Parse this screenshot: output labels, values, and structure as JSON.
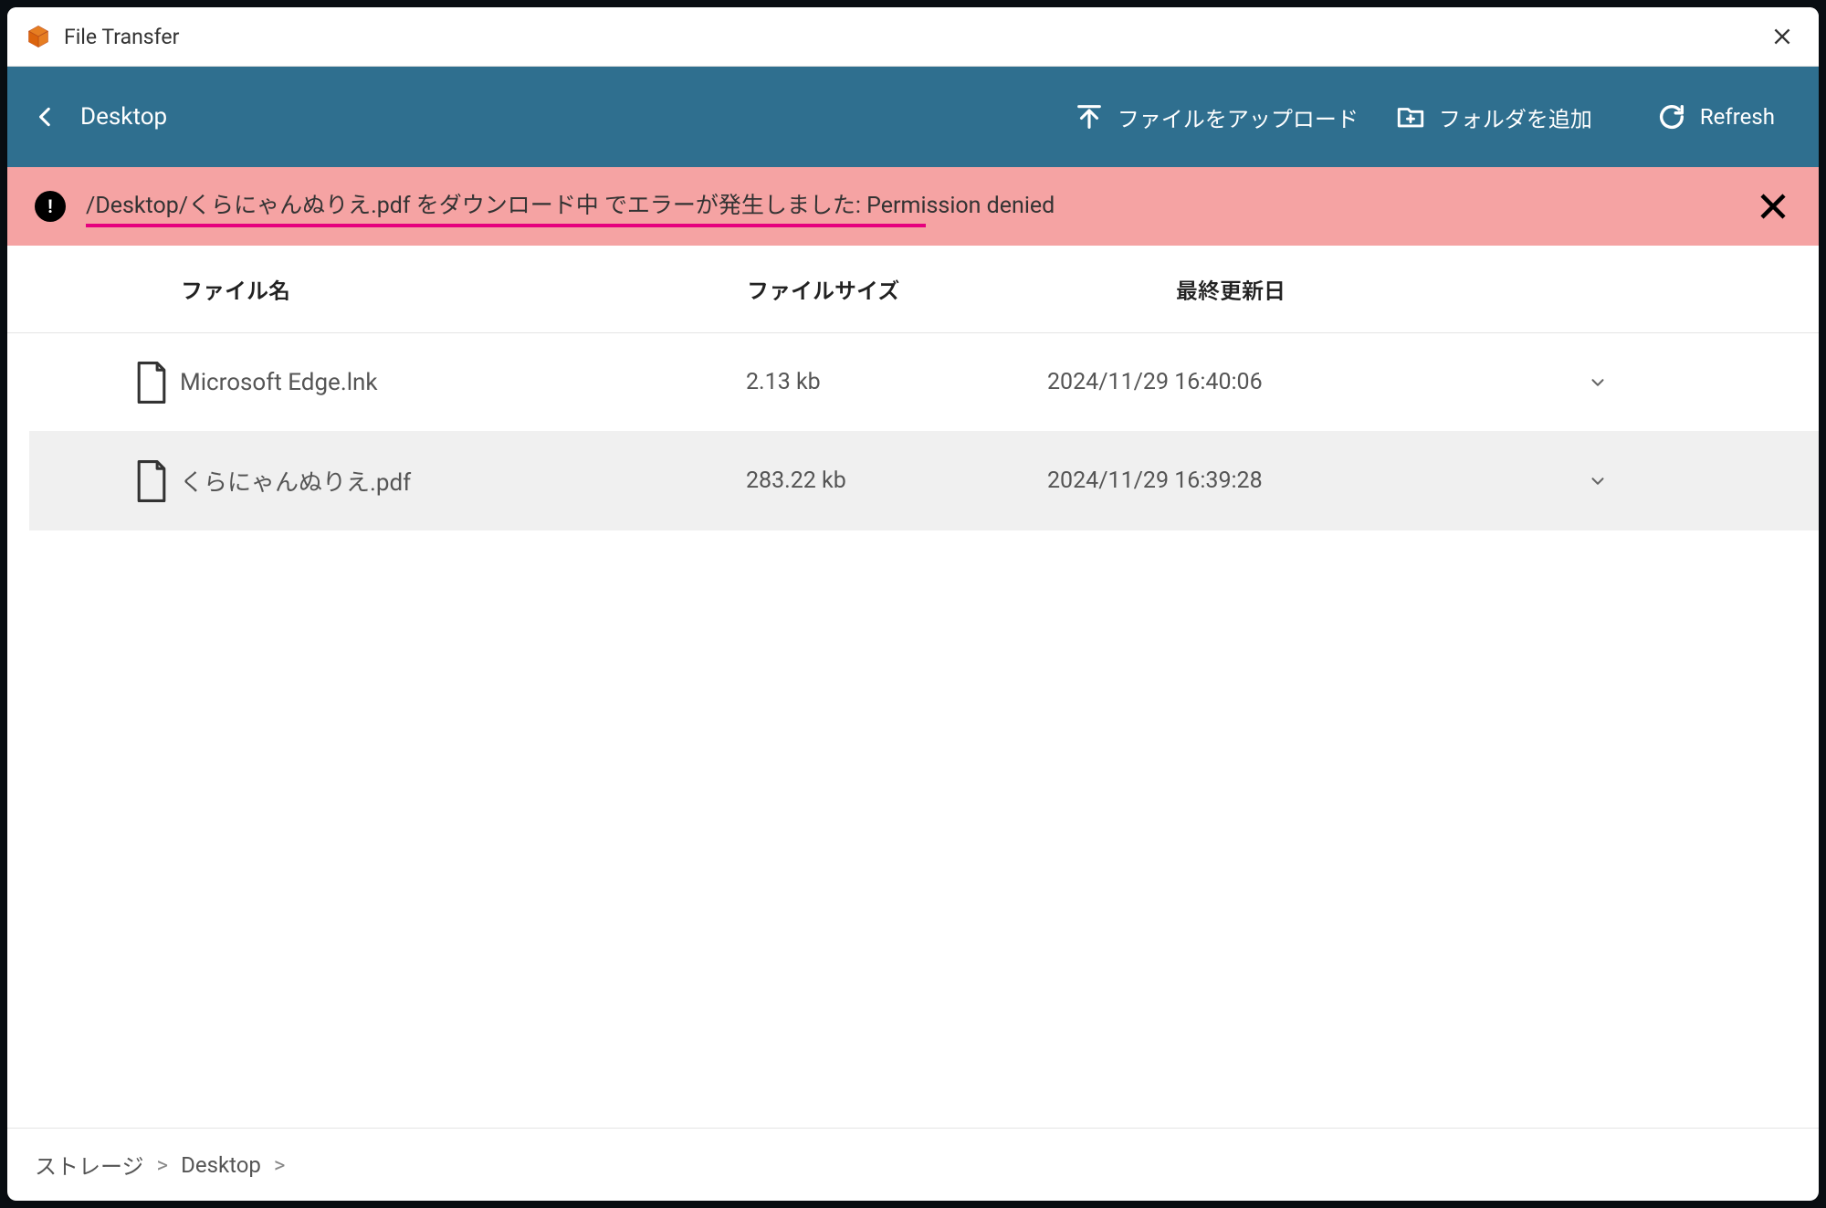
{
  "window": {
    "title": "File Transfer"
  },
  "toolbar": {
    "location": "Desktop",
    "upload_label": "ファイルをアップロード",
    "addfolder_label": "フォルダを追加",
    "refresh_label": "Refresh"
  },
  "error": {
    "message": "/Desktop/くらにゃんぬりえ.pdf をダウンロード中 でエラーが発生しました: Permission denied"
  },
  "table": {
    "columns": {
      "name": "ファイル名",
      "size": "ファイルサイズ",
      "date": "最終更新日"
    },
    "rows": [
      {
        "name": "Microsoft Edge.lnk",
        "size": "2.13 kb",
        "date": "2024/11/29 16:40:06",
        "selected": false
      },
      {
        "name": "くらにゃんぬりえ.pdf",
        "size": "283.22 kb",
        "date": "2024/11/29 16:39:28",
        "selected": true
      }
    ]
  },
  "breadcrumb": {
    "root": "ストレージ",
    "items": [
      "Desktop"
    ]
  }
}
